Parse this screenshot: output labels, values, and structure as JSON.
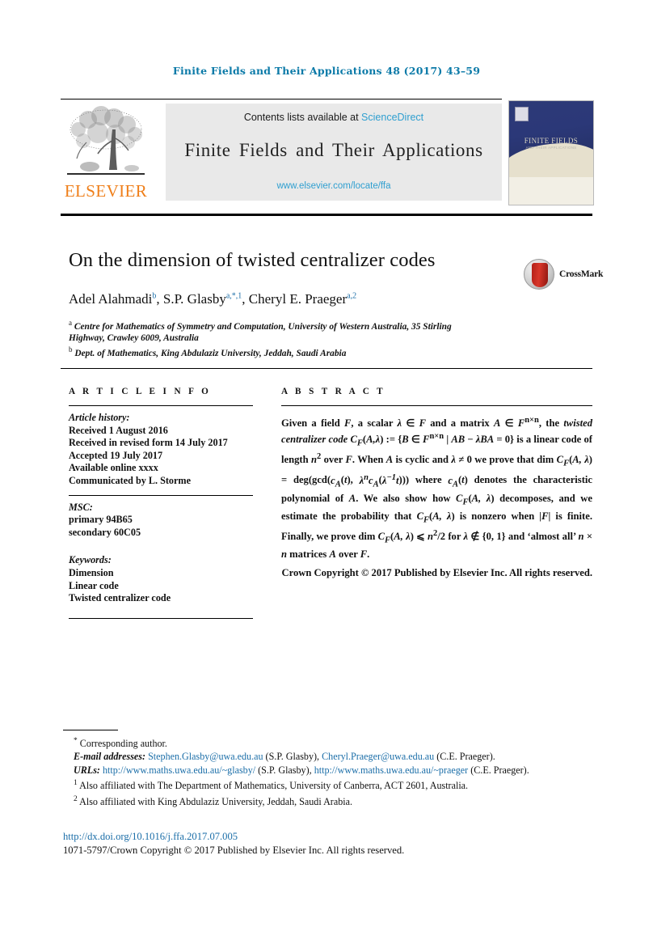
{
  "running_head": "Finite Fields and Their Applications 48 (2017) 43–59",
  "masthead": {
    "contents_prefix": "Contents lists available at ",
    "sciencedirect": "ScienceDirect",
    "journal_name": "Finite Fields and Their Applications",
    "journal_url": "www.elsevier.com/locate/ffa",
    "publisher": "ELSEVIER",
    "cover": {
      "title": "FINITE FIELDS",
      "subtitle": "AND THEIR APPLICATIONS",
      "watermark": "M"
    },
    "link_color": "#2f9fd0",
    "publisher_color": "#ef7f1a"
  },
  "article": {
    "title": "On the dimension of twisted centralizer codes",
    "authors_html": "Adel Alahmadi<sup class=\"sup\">b</sup>, S.P. Glasby<sup class=\"sup\">a,*,1</sup>, Cheryl E. Praeger<sup class=\"sup\">a,2</sup>",
    "affiliations": [
      {
        "mark": "a",
        "text": "Centre for Mathematics of Symmetry and Computation, University of Western Australia, 35 Stirling Highway, Crawley 6009, Australia"
      },
      {
        "mark": "b",
        "text": "Dept. of Mathematics, King Abdulaziz University, Jeddah, Saudi Arabia"
      }
    ],
    "crossmark_label": "CrossMark"
  },
  "info": {
    "heading": "A R T I C L E   I N F O",
    "history_title": "Article history:",
    "history_lines": [
      "Received 1 August 2016",
      "Received in revised form 14 July 2017",
      "Accepted 19 July 2017",
      "Available online xxxx",
      "Communicated by L. Storme"
    ],
    "msc_title": "MSC:",
    "msc_lines": [
      "primary 94B65",
      "secondary 60C05"
    ],
    "keywords_title": "Keywords:",
    "keywords": [
      "Dimension",
      "Linear code",
      "Twisted centralizer code"
    ]
  },
  "abstract": {
    "heading": "A B S T R A C T",
    "body_html": "Given a field <span class=\"mth\">F</span>, a scalar <span class=\"mth\">λ</span> ∈ <span class=\"mth\">F</span> and a matrix <span class=\"mth\">A</span> ∈ <span class=\"mth\">F</span><sup>n×n</sup>, the <em class=\"it\">twisted centralizer code</em> <span class=\"mth\">C<sub>F</sub></span>(<span class=\"mth\">A,λ</span>) := {<span class=\"mth\">B</span> ∈ <span class=\"mth\">F</span><sup>n×n</sup> | <span class=\"mth\">AB</span> − <span class=\"mth\">λBA</span> = 0} is a linear code of length <span class=\"mth\">n</span><sup>2</sup> over <span class=\"mth\">F</span>. When <span class=\"mth\">A</span> is cyclic and <span class=\"mth\">λ</span> ≠ 0 we prove that dim <span class=\"mth\">C<sub>F</sub></span>(<span class=\"mth\">A, λ</span>) = deg(gcd(<span class=\"mth\">c<sub>A</sub></span>(<span class=\"mth\">t</span>), <span class=\"mth\">λ<sup>n</sup>c<sub>A</sub></span>(<span class=\"mth\">λ<sup>−1</sup>t</span>))) where <span class=\"mth\">c<sub>A</sub></span>(<span class=\"mth\">t</span>) denotes the characteristic polynomial of <span class=\"mth\">A</span>. We also show how <span class=\"mth\">C<sub>F</sub></span>(<span class=\"mth\">A, λ</span>) decomposes, and we estimate the probability that <span class=\"mth\">C<sub>F</sub></span>(<span class=\"mth\">A, λ</span>) is nonzero when |<span class=\"mth\">F</span>| is finite. Finally, we prove dim <span class=\"mth\">C<sub>F</sub></span>(<span class=\"mth\">A, λ</span>) ⩽ <span class=\"mth\">n</span><sup>2</sup>/2 for <span class=\"mth\">λ</span> ∉ {0, 1} and ‘almost all’ <span class=\"mth\">n</span> × <span class=\"mth\">n</span> matrices <span class=\"mth\">A</span> over <span class=\"mth\">F</span>.",
    "copyright": "Crown Copyright © 2017 Published by Elsevier Inc. All rights reserved."
  },
  "footnotes": {
    "corresponding": "Corresponding author.",
    "corresponding_mark": "*",
    "email_label": "E-mail addresses:",
    "emails_html": "<span class=\"lnk\">Stephen.Glasby@uwa.edu.au</span> (S.P. Glasby), <span class=\"lnk\">Cheryl.Praeger@uwa.edu.au</span> (C.E. Praeger).",
    "urls_label": "URLs:",
    "urls_html": "<span class=\"lnk\">http://www.maths.uwa.edu.au/~glasby/</span> (S.P. Glasby), <span class=\"lnk\">http://www.maths.uwa.edu.au/~praeger</span> (C.E. Praeger).",
    "note1_mark": "1",
    "note1": "Also affiliated with The Department of Mathematics, University of Canberra, ACT 2601, Australia.",
    "note2_mark": "2",
    "note2": "Also affiliated with King Abdulaziz University, Jeddah, Saudi Arabia."
  },
  "bottom": {
    "doi": "http://dx.doi.org/10.1016/j.ffa.2017.07.005",
    "issn_line": "1071-5797/Crown Copyright © 2017 Published by Elsevier Inc. All rights reserved."
  }
}
